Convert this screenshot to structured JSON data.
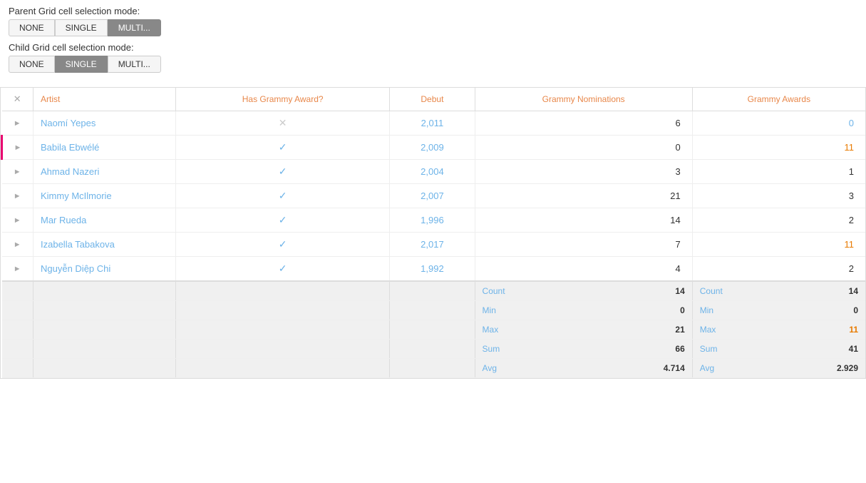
{
  "parent_grid": {
    "label": "Parent Grid cell selection mode:",
    "buttons": [
      "NONE",
      "SINGLE",
      "MULTI..."
    ],
    "active": "MULTI..."
  },
  "child_grid": {
    "label": "Child Grid cell selection mode:",
    "buttons": [
      "NONE",
      "SINGLE",
      "MULTI..."
    ],
    "active": "SINGLE"
  },
  "table": {
    "columns": [
      "",
      "Artist",
      "Has Grammy Award?",
      "Debut",
      "Grammy Nominations",
      "Grammy Awards"
    ],
    "rows": [
      {
        "artist": "Naomí Yepes",
        "hasGrammy": false,
        "debut": "2,011",
        "nominations": "6",
        "awards": "0",
        "awardsClass": "blue"
      },
      {
        "artist": "Babila Ebwélé",
        "hasGrammy": true,
        "debut": "2,009",
        "nominations": "0",
        "awards": "11",
        "awardsClass": "orange",
        "highlighted": true
      },
      {
        "artist": "Ahmad Nazeri",
        "hasGrammy": true,
        "debut": "2,004",
        "nominations": "3",
        "awards": "1",
        "awardsClass": "normal"
      },
      {
        "artist": "Kimmy McIlmorie",
        "hasGrammy": true,
        "debut": "2,007",
        "nominations": "21",
        "awards": "3",
        "awardsClass": "normal"
      },
      {
        "artist": "Mar Rueda",
        "hasGrammy": true,
        "debut": "1,996",
        "nominations": "14",
        "awards": "2",
        "awardsClass": "normal"
      },
      {
        "artist": "Izabella Tabakova",
        "hasGrammy": true,
        "debut": "2,017",
        "nominations": "7",
        "awards": "11",
        "awardsClass": "orange"
      },
      {
        "artist": "Nguyễn Diệp Chi",
        "hasGrammy": true,
        "debut": "1,992",
        "nominations": "4",
        "awards": "2",
        "awardsClass": "normal"
      }
    ],
    "summary": {
      "nominations": {
        "count_label": "Count",
        "count_val": "14",
        "min_label": "Min",
        "min_val": "0",
        "max_label": "Max",
        "max_val": "21",
        "sum_label": "Sum",
        "sum_val": "66",
        "avg_label": "Avg",
        "avg_val": "4.714"
      },
      "awards": {
        "count_label": "Count",
        "count_val": "14",
        "min_label": "Min",
        "min_val": "0",
        "max_label": "Max",
        "max_val": "11",
        "sum_label": "Sum",
        "sum_val": "41",
        "avg_label": "Avg",
        "avg_val": "2.929"
      }
    }
  }
}
